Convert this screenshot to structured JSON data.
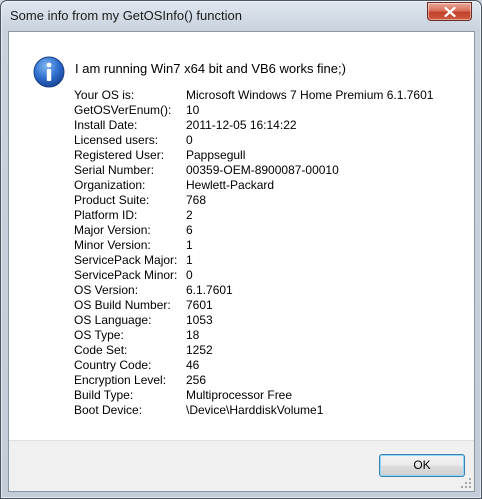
{
  "window": {
    "title": "Some info from my GetOSInfo() function",
    "close_icon": "close-icon"
  },
  "dialog": {
    "icon": "information-icon",
    "message": "I am running Win7 x64 bit and VB6 works fine;)",
    "rows": [
      {
        "label": "Your OS is:",
        "value": "Microsoft Windows 7 Home Premium   6.1.7601"
      },
      {
        "label": "GetOSVerEnum():",
        "value": "10"
      },
      {
        "label": "Install Date:",
        "value": "2011-12-05 16:14:22"
      },
      {
        "label": "Licensed users:",
        "value": "0"
      },
      {
        "label": "Registered User:",
        "value": "Pappsegull"
      },
      {
        "label": "Serial Number:",
        "value": "00359-OEM-8900087-00010"
      },
      {
        "label": "Organization:",
        "value": "Hewlett-Packard"
      },
      {
        "label": "Product Suite:",
        "value": "768"
      },
      {
        "label": "Platform ID:",
        "value": "2"
      },
      {
        "label": "Major Version:",
        "value": "6"
      },
      {
        "label": "Minor Version:",
        "value": "1"
      },
      {
        "label": "ServicePack Major:",
        "value": "1"
      },
      {
        "label": "ServicePack Minor:",
        "value": "0"
      },
      {
        "label": "OS Version:",
        "value": "6.1.7601"
      },
      {
        "label": "OS Build Number:",
        "value": "7601"
      },
      {
        "label": "OS Language:",
        "value": "1053"
      },
      {
        "label": "OS Type:",
        "value": "18"
      },
      {
        "label": "Code Set:",
        "value": "1252"
      },
      {
        "label": "Country Code:",
        "value": "46"
      },
      {
        "label": "Encryption Level:",
        "value": "256"
      },
      {
        "label": "Build Type:",
        "value": "Multiprocessor Free"
      },
      {
        "label": "Boot Device:",
        "value": "\\Device\\HarddiskVolume1"
      }
    ],
    "ok_label": "OK"
  },
  "colors": {
    "info_icon_blue": "#1f5fbf",
    "ok_border": "#3c7fb1",
    "close_red": "#c2402b"
  }
}
